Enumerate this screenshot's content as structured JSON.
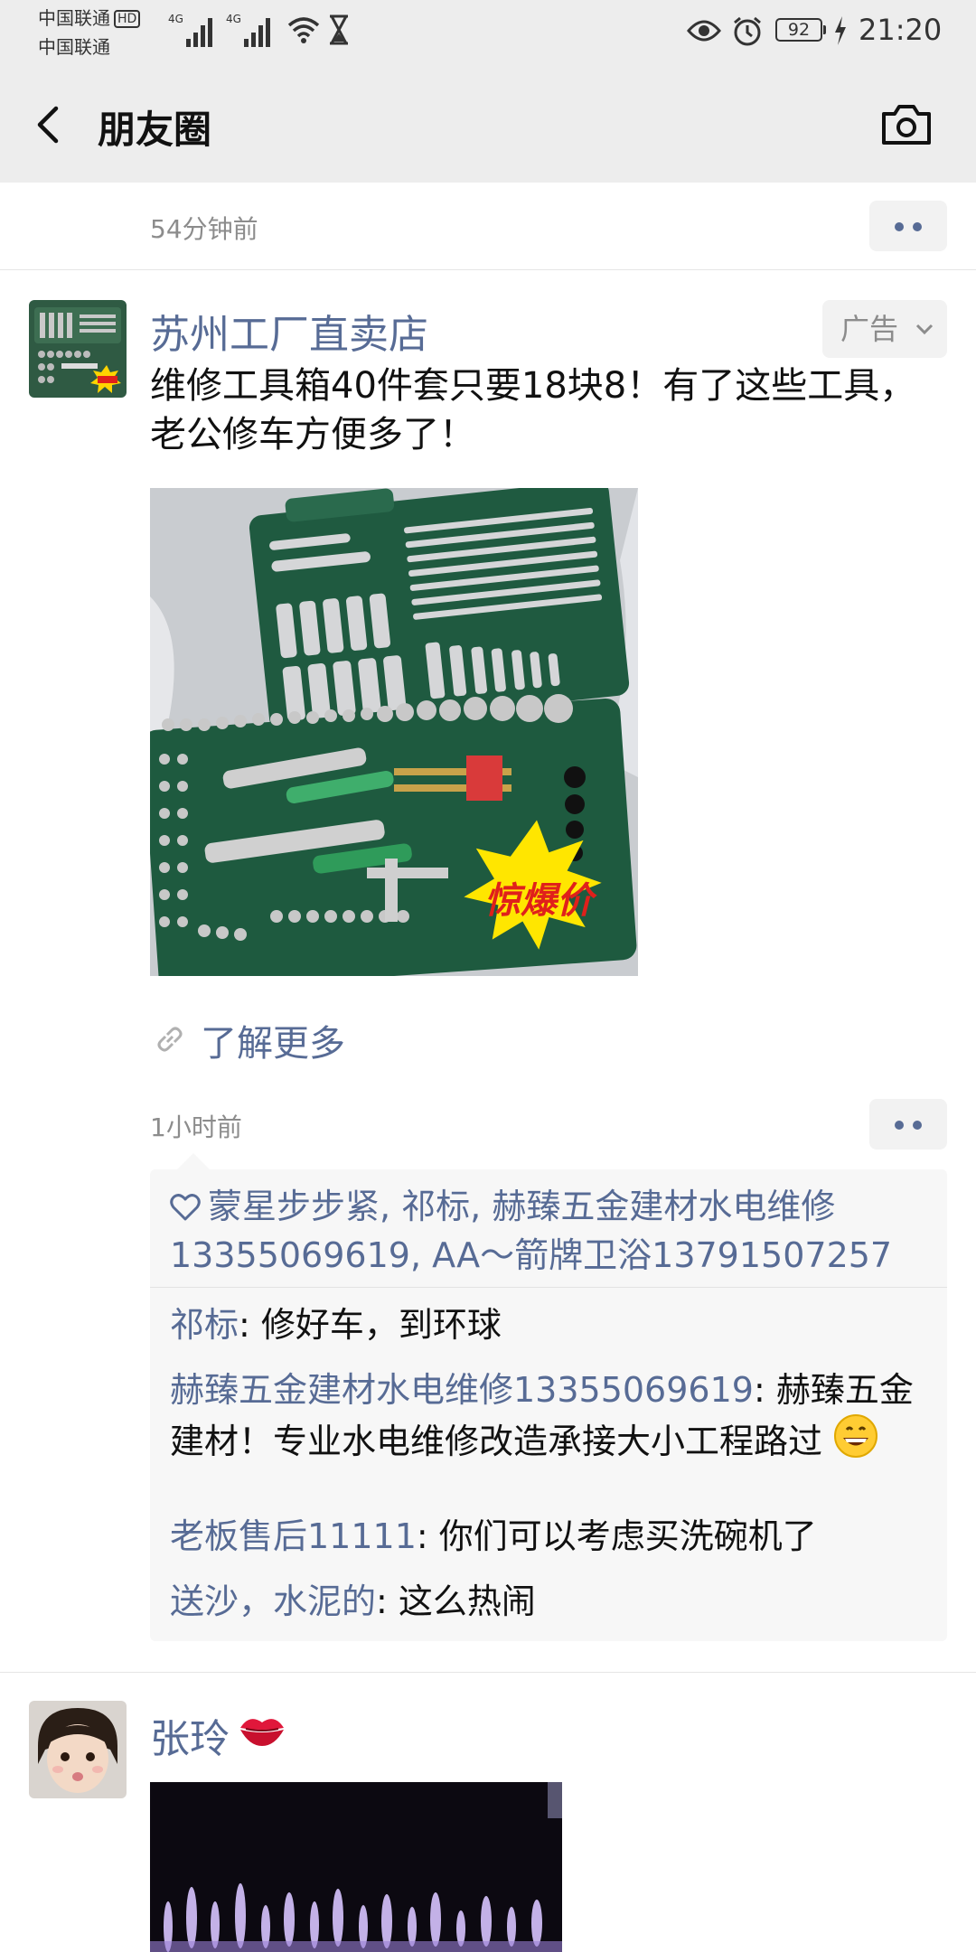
{
  "status_bar": {
    "carrier_1": "中国联通",
    "carrier_1_badge": "HD",
    "carrier_2": "中国联通",
    "signal_1_label": "4G",
    "signal_2_label": "4G",
    "battery": "92",
    "time": "21:20"
  },
  "header": {
    "title": "朋友圈"
  },
  "posts": [
    {
      "time": "54分钟前"
    },
    {
      "author": "苏州工厂直卖店",
      "ad_label": "广告",
      "text": "维修工具箱40件套只要18块8！有了这些工具，老公修车方便多了！",
      "image_badge": "惊爆价",
      "link_text": "了解更多",
      "time": "1小时前",
      "likes": "蒙星步步紧, 祁标, 赫臻五金建材水电维修13355069619, AA～箭牌卫浴13791507257",
      "comments": [
        {
          "author": "祁标",
          "text": ": 修好车，到环球"
        },
        {
          "author": "赫臻五金建材水电维修13355069619",
          "text": ": 赫臻五金建材！专业水电维修改造承接大小工程路过"
        },
        {
          "author": "老板售后11111",
          "text": ": 你们可以考虑买洗碗机了"
        },
        {
          "author": "送沙，水泥的",
          "text": ": 这么热闹"
        }
      ]
    },
    {
      "author": "张玲"
    }
  ],
  "colors": {
    "link_blue": "#576b95",
    "header_bg": "#ededed",
    "comment_bg": "#f7f7f7",
    "secondary_text": "#8c8c8c"
  }
}
